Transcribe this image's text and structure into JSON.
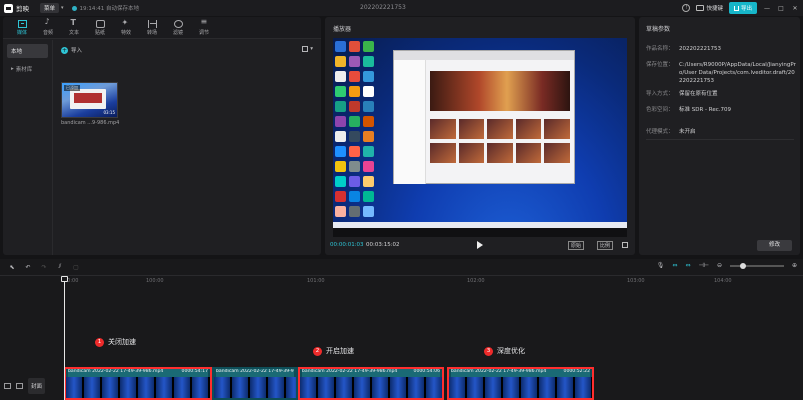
{
  "app": {
    "logo_text": "剪映",
    "menu_label": "菜单",
    "save_status": "19:14:41 自动保存本地",
    "project_title": "202202221753",
    "shortcut_label": "快捷键",
    "export_label": "导出"
  },
  "media_panel": {
    "tabs": [
      {
        "label": "媒体",
        "icon": "media-icon"
      },
      {
        "label": "音频",
        "icon": "audio-icon"
      },
      {
        "label": "文本",
        "icon": "text-icon"
      },
      {
        "label": "贴纸",
        "icon": "sticker-icon"
      },
      {
        "label": "特效",
        "icon": "effect-icon"
      },
      {
        "label": "转场",
        "icon": "transition-icon"
      },
      {
        "label": "滤镜",
        "icon": "filter-icon"
      },
      {
        "label": "调节",
        "icon": "adjust-icon"
      }
    ],
    "side_local": "本地",
    "side_library": "素材库",
    "import_label": "导入",
    "view_label": "",
    "thumb_added": "已添加",
    "thumb_duration": "03:15",
    "media_name": "bandicam ...9-986.mp4"
  },
  "player": {
    "title": "播放器",
    "time_current": "00:00:01:03",
    "time_total": "00:03:15:02",
    "ratio_btn": "原始",
    "ratio_btn2": "比例"
  },
  "properties": {
    "title": "草稿参数",
    "rows": [
      {
        "key": "作品名称：",
        "value": "202202221753"
      },
      {
        "key": "保存位置：",
        "value": "C:/Users/R9000P/AppData/Local/JianyingPro/User Data/Projects/com.lveditor.draft/202202221753"
      },
      {
        "key": "导入方式：",
        "value": "保留在原有位置"
      },
      {
        "key": "色彩空间：",
        "value": "标准 SDR - Rec.709"
      },
      {
        "key": "代理模式：",
        "value": "未开启"
      }
    ],
    "modify_label": "修改"
  },
  "timeline": {
    "ruler_ticks": [
      "00:00",
      "100:00",
      "101:00",
      "102:00",
      "103:00",
      "104:00"
    ],
    "cover_label": "封面",
    "clips": [
      {
        "name": "bandicam 2022-02-22 17-49-39-986.mp4",
        "duration": "0000:54:17"
      },
      {
        "name": "bandicam 2022-02-22 17-49-39-986.mp4",
        "duration": ""
      },
      {
        "name": "bandicam 2022-02-22 17-49-39-986.mp4",
        "duration": "0000:54:06"
      },
      {
        "name": "bandicam 2022-02-22 17-49-39-986.mp4",
        "duration": "0000:52:22"
      }
    ],
    "badges": [
      {
        "num": "1",
        "label": "关闭加速"
      },
      {
        "num": "2",
        "label": "开启加速"
      },
      {
        "num": "3",
        "label": "深度优化"
      }
    ]
  },
  "colors": {
    "accent": "#2ec5d6",
    "highlight_border": "#ff2e2e",
    "badge": "#ee2b2b"
  }
}
